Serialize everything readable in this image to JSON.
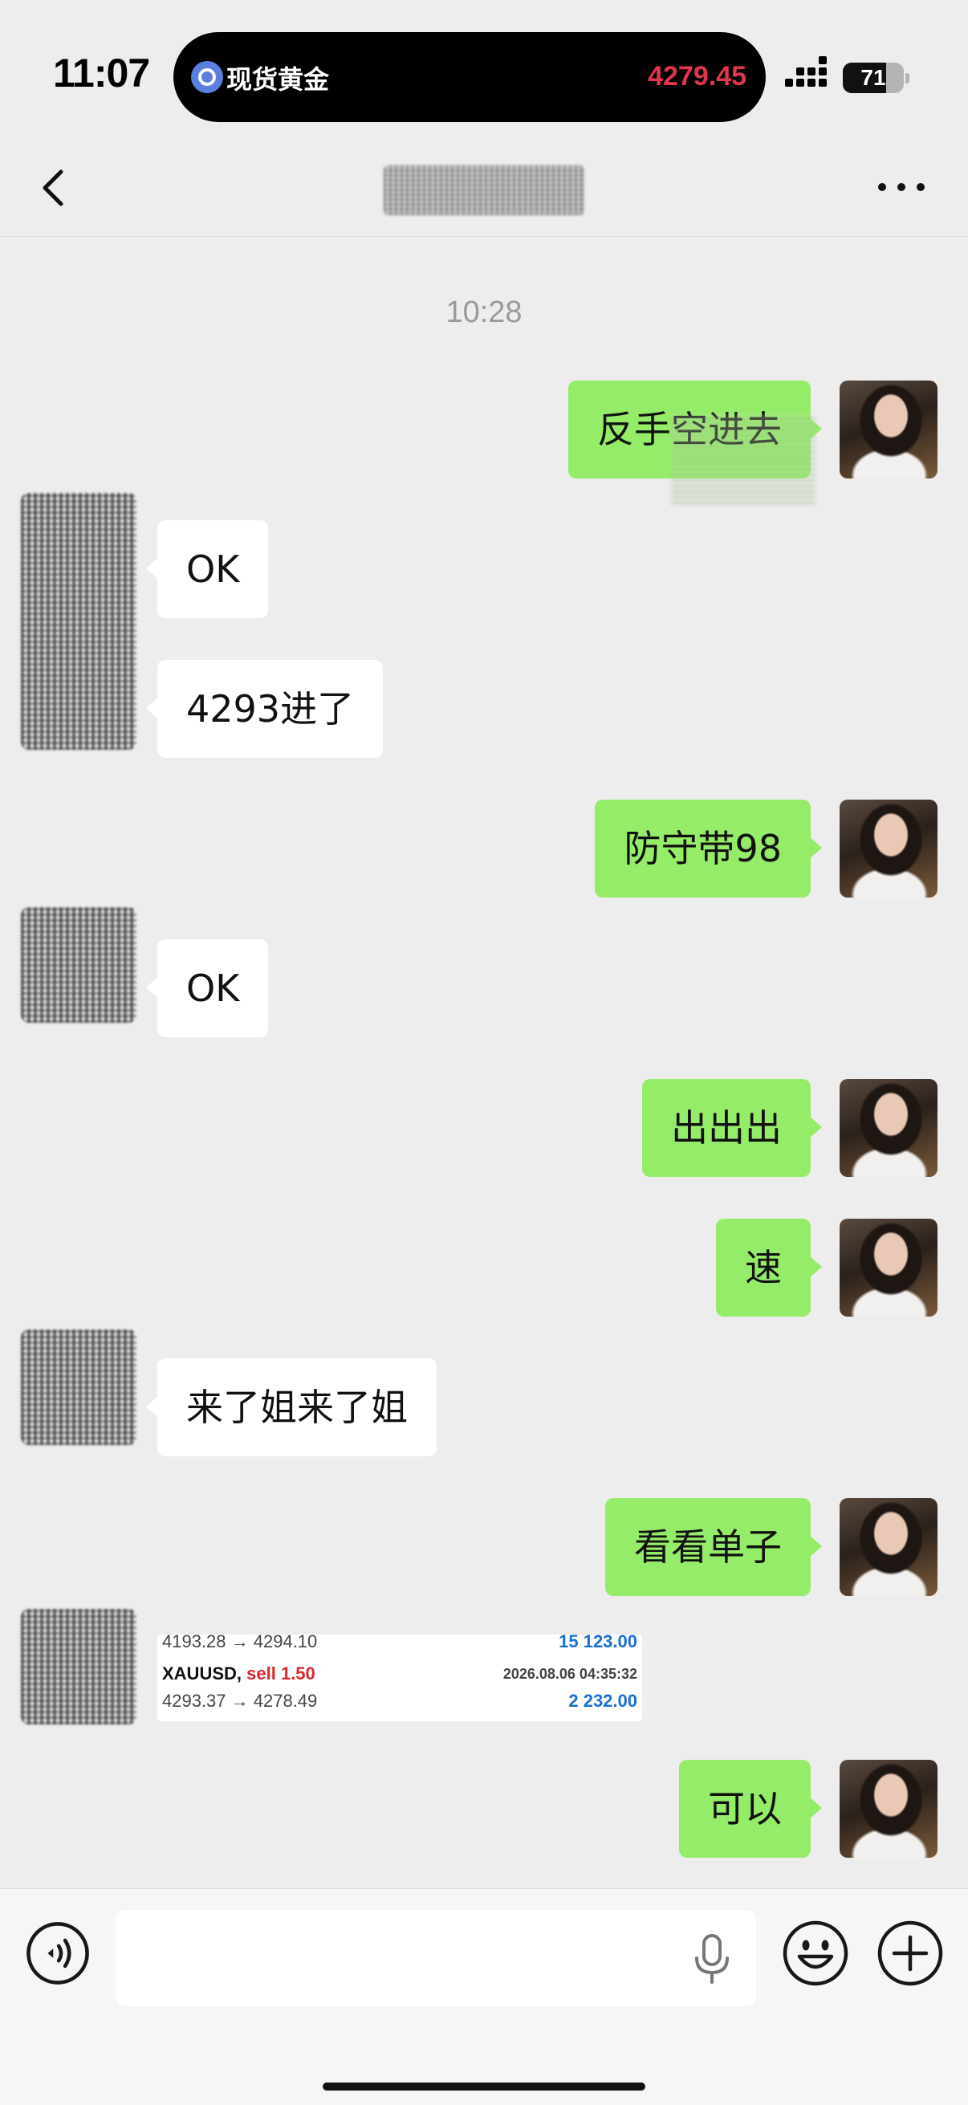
{
  "status_bar": {
    "time": "11:07",
    "live_activity": {
      "title": "现货黄金",
      "price": "4279.45",
      "price_color": "#e2364f"
    },
    "battery_level": "71"
  },
  "nav": {
    "back_icon": "chevron-left-icon",
    "more_icon": "more-dots-icon"
  },
  "conversation": {
    "timestamp": "10:28",
    "messages": [
      {
        "side": "out",
        "text": "反手空进去"
      },
      {
        "side": "in",
        "text": "OK"
      },
      {
        "side": "in",
        "text": "4293进了"
      },
      {
        "side": "out",
        "text": "防守带98"
      },
      {
        "side": "in",
        "text": "OK"
      },
      {
        "side": "out",
        "text": "出出出"
      },
      {
        "side": "out",
        "text": "速"
      },
      {
        "side": "in",
        "text": "来了姐来了姐"
      },
      {
        "side": "out",
        "text": "看看单子"
      },
      {
        "side": "in",
        "type": "image"
      },
      {
        "side": "out",
        "text": "可以"
      }
    ]
  },
  "trade_card": {
    "line1_prices": "4193.28 → 4294.10",
    "line1_profit": "15 123.00",
    "symbol": "XAUUSD,",
    "direction": "sell 1.50",
    "datetime": "2026.08.06 04:35:32",
    "line3_prices": "4293.37 → 4278.49",
    "line3_profit": "2 232.00"
  },
  "input_bar": {
    "input_value": "",
    "voice_icon": "voice-mode-icon",
    "mic_icon": "microphone-icon",
    "emoji_icon": "emoji-icon",
    "plus_icon": "plus-icon"
  },
  "colors": {
    "outgoing_bubble": "#95ec69",
    "incoming_bubble": "#ffffff",
    "background": "#ededed",
    "profit_blue": "#1a6fd6",
    "sell_red": "#d7262e"
  }
}
